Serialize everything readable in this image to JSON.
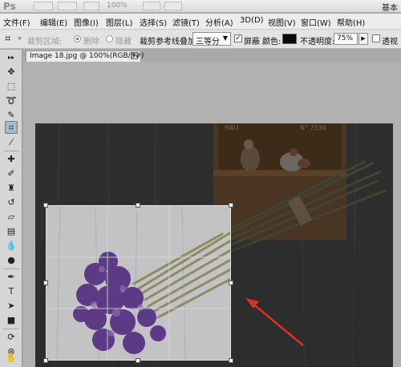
{
  "appbar": {
    "logo": "Ps",
    "zoom": "100%",
    "workspace": "基本功"
  },
  "menu": [
    {
      "label": "文件(F)"
    },
    {
      "label": "编辑(E)"
    },
    {
      "label": "图像(I)"
    },
    {
      "label": "图层(L)"
    },
    {
      "label": "选择(S)"
    },
    {
      "label": "滤镜(T)"
    },
    {
      "label": "分析(A)"
    },
    {
      "label": "3D(D)"
    },
    {
      "label": "视图(V)"
    },
    {
      "label": "窗口(W)"
    },
    {
      "label": "帮助(H)"
    }
  ],
  "options": {
    "crop_area_label": "裁剪区域:",
    "delete_label": "删除",
    "hide_label": "隐藏",
    "overlay_label": "裁剪参考线叠加:",
    "overlay_value": "三等分",
    "shield_label": "屏蔽",
    "color_label": "颜色:",
    "shield_color": "#0a0a0a",
    "opacity_label": "不透明度:",
    "opacity_value": "75%",
    "perspective_label": "透视"
  },
  "document": {
    "tab_title": "Image 18.jpg @ 100%(RGB/8#)"
  },
  "photo": {
    "sign_text": "N° 7534",
    "sign_text_left": "HAU"
  }
}
